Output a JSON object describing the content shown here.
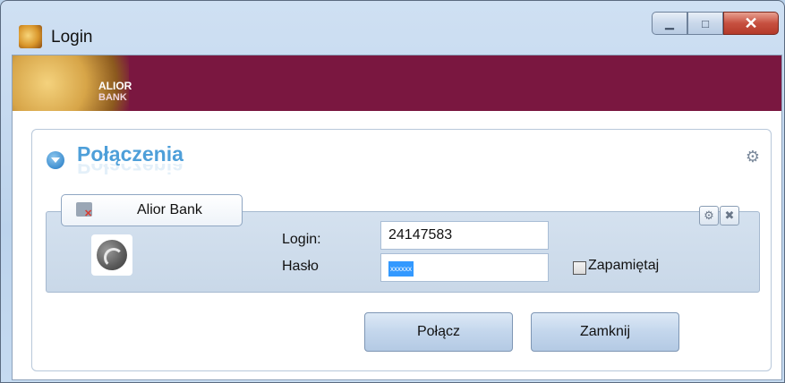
{
  "window": {
    "title": "Login"
  },
  "titlebar": {
    "buttons": [
      {
        "icon": "minimize-icon"
      },
      {
        "icon": "maximize-icon"
      },
      {
        "icon": "close-icon"
      }
    ]
  },
  "banner": {
    "logo_line1": "ALIOR",
    "logo_line2": "BANK",
    "color": "#7a1740"
  },
  "section": {
    "title": "Połączenia",
    "icon": "chevron-down-circle-icon",
    "settings_icon": "gear-icon",
    "accent": "#4e9fd9"
  },
  "connection": {
    "tab_label": "Alior Bank",
    "tab_icon": "disconnected-x-icon",
    "globe_icon": "globe-icon",
    "login_label": "Login:",
    "login_value": "24147583",
    "password_label": "Hasło",
    "password_mask": "xxxxxx",
    "remember_label": "Zapamiętaj",
    "remember_checked": false
  },
  "actions": {
    "connect_label": "Połącz",
    "close_label": "Zamknij"
  }
}
